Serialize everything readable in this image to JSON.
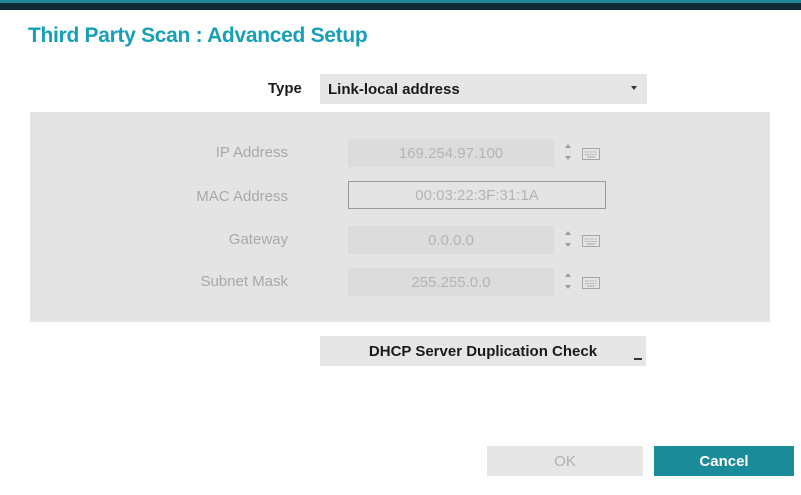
{
  "dialog": {
    "title": "Third Party Scan : Advanced Setup"
  },
  "type": {
    "label": "Type",
    "value": "Link-local address"
  },
  "fields": [
    {
      "label": "IP Address",
      "value": "169.254.97.100",
      "spinner": true,
      "keyboard": true
    },
    {
      "label": "MAC Address",
      "value": "00:03:22:3F:31:1A",
      "spinner": false,
      "keyboard": false
    },
    {
      "label": "Gateway",
      "value": "0.0.0.0",
      "spinner": true,
      "keyboard": true
    },
    {
      "label": "Subnet Mask",
      "value": "255.255.0.0",
      "spinner": true,
      "keyboard": true
    }
  ],
  "buttons": {
    "dhcp_check": "DHCP Server Duplication Check",
    "ok": "OK",
    "cancel": "Cancel"
  },
  "icons": {
    "spinner": "up-down-spinner-icon",
    "keyboard": "keyboard-icon",
    "dropdown": "dropdown-arrow-icon"
  },
  "colors": {
    "title": "#16a0b8",
    "accent_button": "#1a8b99",
    "panel_background": "#e4e4e4",
    "disabled_text": "#a8a8a8"
  }
}
